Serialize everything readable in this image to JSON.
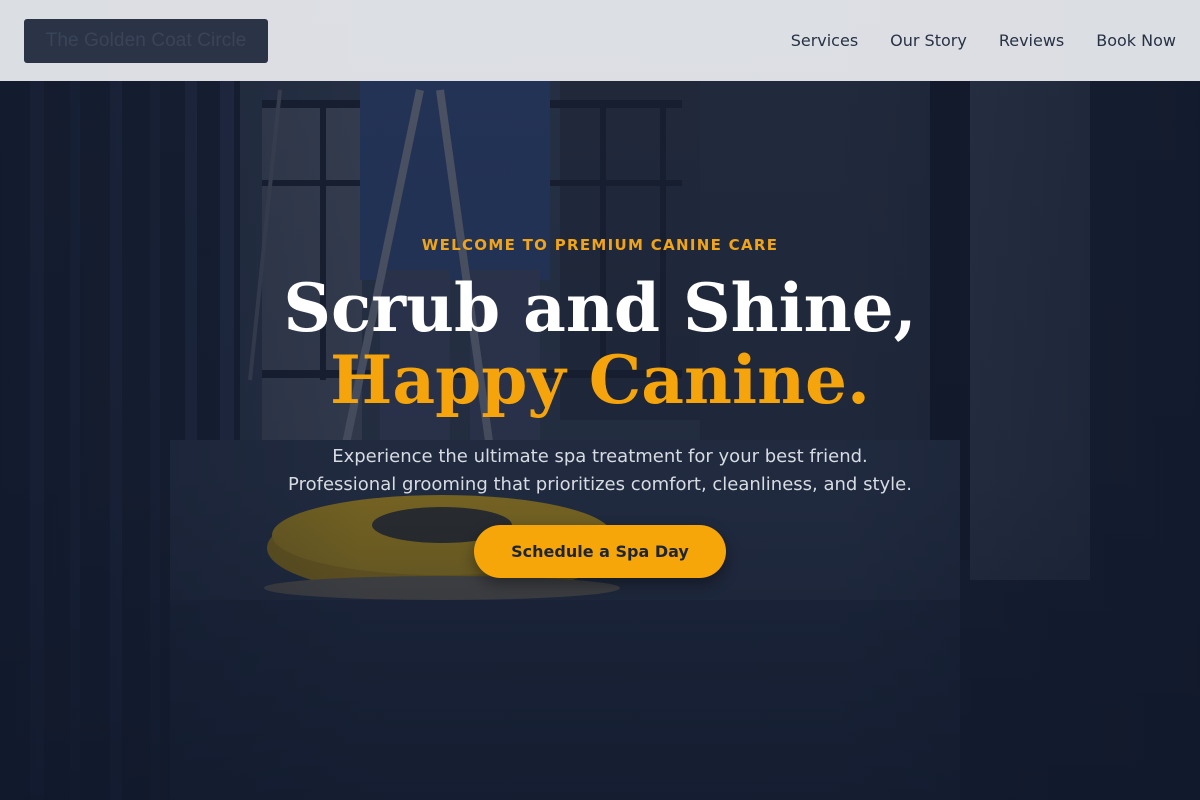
{
  "nav": {
    "logo_text": "The Golden Coat Circle",
    "links": [
      "Services",
      "Our Story",
      "Reviews",
      "Book Now"
    ]
  },
  "hero": {
    "eyebrow": "WELCOME TO PREMIUM CANINE CARE",
    "headline_line1": "Scrub and Shine,",
    "headline_line2": "Happy Canine.",
    "subtext_line1": "Experience the ultimate spa treatment for your best friend.",
    "subtext_line2": "Professional grooming that prioritizes comfort, cleanliness, and style.",
    "cta_label": "Schedule a Spa Day"
  },
  "colors": {
    "accent": "#f5a50b",
    "navbar_bg": "#ebedf0",
    "logo_bg": "#2b3447",
    "hero_overlay": "#0f172a"
  },
  "icons": {
    "hero_image": "pressure-washer-photo"
  }
}
